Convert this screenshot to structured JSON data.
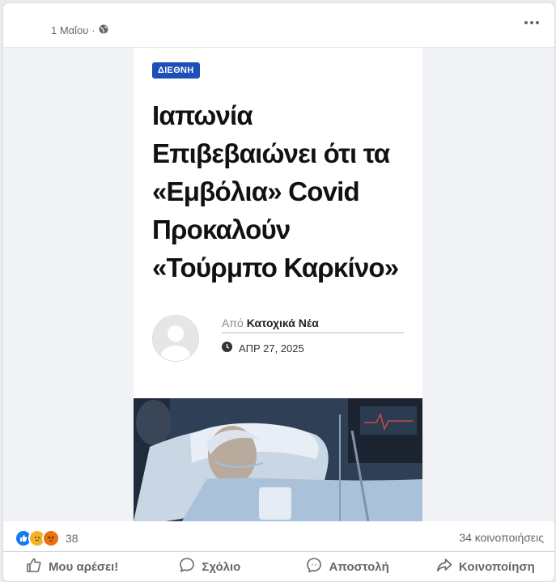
{
  "post": {
    "timestamp": "1 Μαΐου",
    "separator": "·",
    "audience_icon": "globe-icon",
    "more_icon": "more-horizontal-icon"
  },
  "article": {
    "tag": "ΔΙΕΘΝΗ",
    "headline": "Ιαπωνία Επιβεβαιώνει ότι τα «Εμβόλια» Covid Προκαλούν «Τούρμπο Καρκίνο»",
    "by_prefix": "Από",
    "author": "Κατοχικά Νέα",
    "date": "ΑΠΡ 27, 2025",
    "colors": {
      "tag_bg": "#1d4fb8",
      "headline": "#111111"
    }
  },
  "footer": {
    "reactions": [
      "like",
      "sad",
      "angry"
    ],
    "reaction_count": "38",
    "shares": "34 κοινοποιήσεις",
    "actions": [
      {
        "label": "Μου αρέσει!",
        "icon": "thumbs-up-icon"
      },
      {
        "label": "Σχόλιο",
        "icon": "comment-icon"
      },
      {
        "label": "Αποστολή",
        "icon": "messenger-icon"
      },
      {
        "label": "Κοινοποίηση",
        "icon": "share-icon"
      }
    ]
  }
}
